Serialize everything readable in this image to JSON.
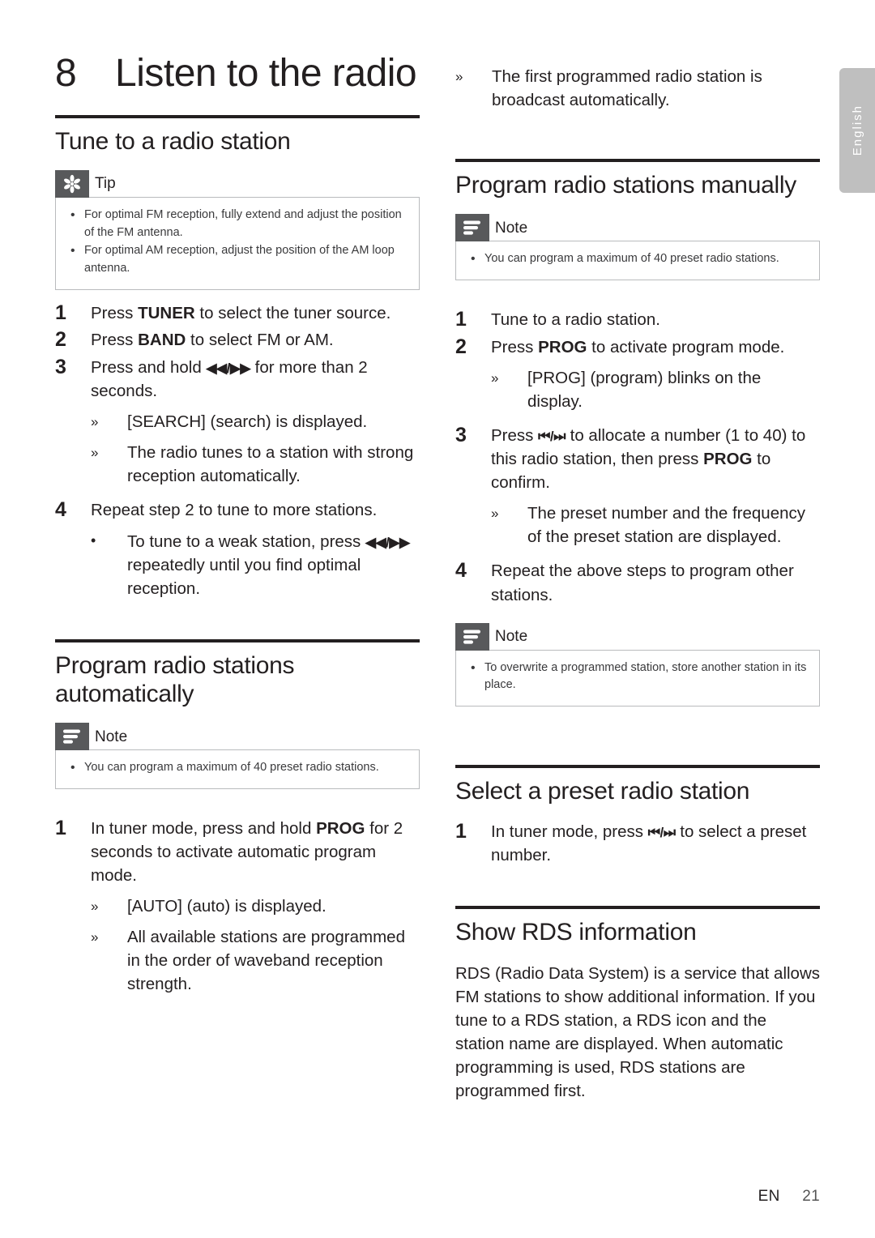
{
  "language_tab": {
    "label": "English"
  },
  "chapter": {
    "number": "8",
    "title": "Listen to the radio"
  },
  "footer": {
    "lang_code": "EN",
    "page_number": "21"
  },
  "left_column": {
    "section1": {
      "heading": "Tune to a radio station",
      "tip": {
        "icon": "tip-asterisk-icon",
        "label": "Tip",
        "items": [
          "For optimal FM reception, fully extend and adjust the position of the FM antenna.",
          "For optimal AM reception, adjust the position of the AM loop antenna."
        ]
      },
      "steps": [
        {
          "num": "1",
          "text_pre": "Press ",
          "bold": "TUNER",
          "text_post": " to select the tuner source."
        },
        {
          "num": "2",
          "text_pre": "Press ",
          "bold": "BAND",
          "text_post": " to select FM or AM."
        },
        {
          "num": "3",
          "text_pre": "Press and hold ",
          "glyph": "◀◀/▶▶",
          "text_post": " for more than 2 seconds."
        },
        {
          "num": "4",
          "text_pre": "Repeat step 2 to tune to more stations.",
          "bold": "",
          "text_post": ""
        }
      ],
      "step3_subs": [
        "[SEARCH] (search) is displayed.",
        "The radio tunes to a station with strong reception automatically."
      ],
      "step4_sub_pre": "To tune to a weak station, press ",
      "step4_sub_glyph": "◀◀/▶▶",
      "step4_sub_post": " repeatedly until you find optimal reception."
    },
    "section2": {
      "heading": "Program radio stations automatically",
      "note": {
        "icon": "note-lines-icon",
        "label": "Note",
        "items": [
          "You can program a maximum of 40 preset radio stations."
        ]
      },
      "step1": {
        "num": "1",
        "text_pre": "In tuner mode, press and hold ",
        "bold": "PROG",
        "text_post": " for 2 seconds to activate automatic program mode."
      },
      "step1_subs": [
        "[AUTO] (auto) is displayed.",
        "All available stations are programmed in the order of waveband reception strength."
      ]
    }
  },
  "right_column": {
    "continued_sub": "The first programmed radio station is broadcast automatically.",
    "section3": {
      "heading": "Program radio stations manually",
      "note": {
        "icon": "note-lines-icon",
        "label": "Note",
        "items": [
          "You can program a maximum of 40 preset radio stations."
        ]
      },
      "step1": {
        "num": "1",
        "text": "Tune to a radio station."
      },
      "step2": {
        "num": "2",
        "text_pre": "Press ",
        "bold": "PROG",
        "text_post": " to activate program mode."
      },
      "step2_sub": "[PROG] (program) blinks on the display.",
      "step3": {
        "num": "3",
        "text_pre": "Press ",
        "glyph": "⏮/⏭",
        "text_mid": " to allocate a number (1 to 40) to this radio station, then press ",
        "bold": "PROG",
        "text_post": " to confirm."
      },
      "step3_sub": "The preset number and the frequency of the preset station are displayed.",
      "step4": {
        "num": "4",
        "text": "Repeat the above steps to program other stations."
      },
      "note2": {
        "icon": "note-lines-icon",
        "label": "Note",
        "items": [
          "To overwrite a programmed station, store another station in its place."
        ]
      }
    },
    "section4": {
      "heading": "Select a preset radio station",
      "step1": {
        "num": "1",
        "text_pre": "In tuner mode, press ",
        "glyph": "⏮/⏭",
        "text_post": " to select a preset number."
      }
    },
    "section5": {
      "heading": "Show RDS information",
      "paragraph": "RDS (Radio Data System) is a service that allows FM stations to show additional information. If you tune to a RDS station, a RDS icon and the station name are displayed. When automatic programming is used, RDS stations are programmed first."
    }
  }
}
